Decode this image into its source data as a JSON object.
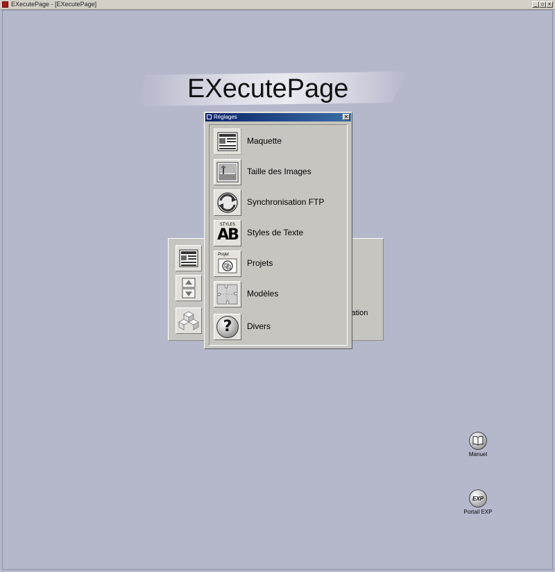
{
  "window": {
    "title": "EXecutePage - [EXecutePage]",
    "controls": [
      "minimize-icon",
      "restore-icon",
      "close-icon"
    ],
    "background_color": "#b5b7cb"
  },
  "header": {
    "logo_text": "EXecutePage"
  },
  "background_panel": {
    "tools": [
      {
        "icon": "layout-grid-icon"
      },
      {
        "icon": "up-down-arrows-icon"
      },
      {
        "icon": "cubes-icon"
      }
    ],
    "partial_label": "sation"
  },
  "reglages": {
    "title": "Réglages",
    "close_symbol": "✕",
    "items": [
      {
        "label": "Maquette",
        "icon": "layout-grid-icon"
      },
      {
        "label": "Taille des Images",
        "icon": "landscape-photo-icon"
      },
      {
        "label": "Synchronisation FTP",
        "icon": "sync-arrows-icon"
      },
      {
        "label": "Styles de Texte",
        "icon": "text-styles-icon",
        "icon_caption": "STYLES",
        "icon_text": "AB"
      },
      {
        "label": "Projets",
        "icon": "projects-icon",
        "icon_caption": "Projet"
      },
      {
        "label": "Modèles",
        "icon": "puzzle-icon"
      },
      {
        "label": "Divers",
        "icon": "question-mark-icon",
        "icon_text": "?"
      }
    ]
  },
  "shortcuts": [
    {
      "label": "Manuel",
      "icon": "book-icon"
    },
    {
      "label": "Portail EXP",
      "icon": "exp-portal-icon",
      "icon_text": "EXP"
    }
  ]
}
